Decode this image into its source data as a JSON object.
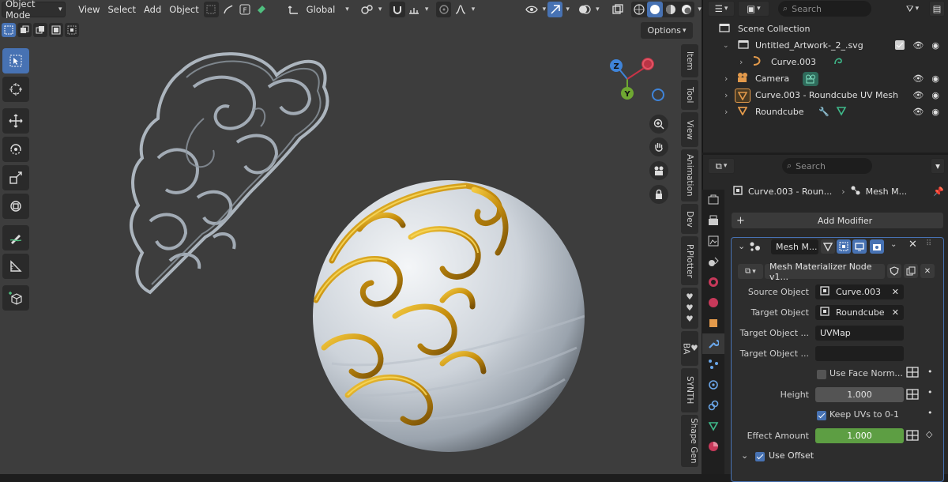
{
  "header": {
    "mode_label": "Object Mode",
    "menus": [
      "View",
      "Select",
      "Add",
      "Object"
    ],
    "transform_orientation": "Global"
  },
  "viewport": {
    "options_label": "Options",
    "gizmo": {
      "z_label": "Z",
      "y_label": "Y"
    },
    "n_tabs": [
      "Item",
      "Tool",
      "View",
      "Animation",
      "Dev",
      "P.Plotter",
      "BA",
      "SYNTH",
      "Shape Gen"
    ]
  },
  "outliner": {
    "search_placeholder": "Search",
    "root": "Scene Collection",
    "rows": [
      {
        "label": "Untitled_Artwork-_2_.svg"
      },
      {
        "label": "Curve.003"
      },
      {
        "label": "Camera"
      },
      {
        "label": "Curve.003 - Roundcube UV Mesh"
      },
      {
        "label": "Roundcube"
      }
    ]
  },
  "properties": {
    "search_placeholder": "Search",
    "breadcrumb": {
      "object": "Curve.003 - Roun...",
      "modifier": "Mesh M..."
    },
    "add_modifier_label": "Add Modifier",
    "modifier": {
      "name": "Mesh M...",
      "node_group": "Mesh Materializer Node v1...",
      "fields": {
        "source_object_label": "Source Object",
        "source_object_value": "Curve.003",
        "target_object_label": "Target Object",
        "target_object_value": "Roundcube",
        "target_uv_label": "Target Object ...",
        "target_uv_value": "UVMap",
        "target_extra_label": "Target Object ...",
        "use_face_normals_label": "Use Face Norm...",
        "height_label": "Height",
        "height_value": "1.000",
        "keep_uvs_label": "Keep UVs to 0-1",
        "effect_amount_label": "Effect Amount",
        "effect_amount_value": "1.000",
        "use_offset_label": "Use Offset"
      },
      "checks": {
        "use_face_normals": false,
        "keep_uvs": true,
        "use_offset": true
      }
    }
  },
  "colors": {
    "accent": "#4772b3",
    "effect_bar": "#5d9e43",
    "viewport_bg": "#3d3d3d",
    "panel_bg": "#282828",
    "gold": "#d9a21a"
  }
}
